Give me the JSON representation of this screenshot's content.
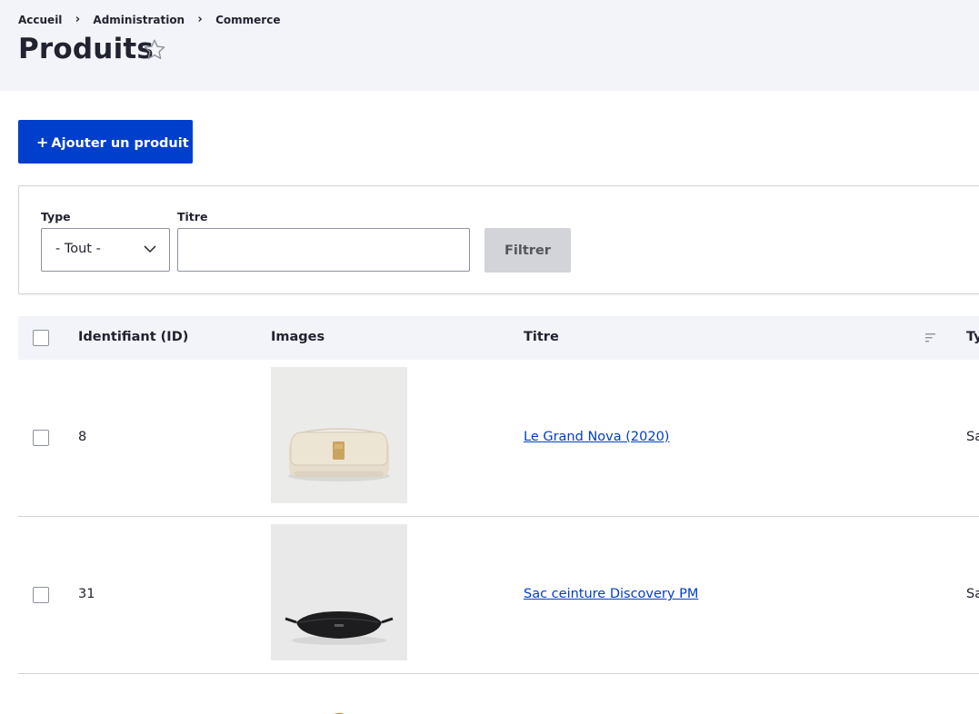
{
  "breadcrumb": {
    "items": [
      "Accueil",
      "Administration",
      "Commerce"
    ],
    "separator": "›"
  },
  "page": {
    "title": "Produits",
    "favorite_icon": "star-outline-icon"
  },
  "actions": {
    "add_product_plus": "+",
    "add_product_label": "Ajouter un produit",
    "accent_color": "#003ecc"
  },
  "filters": {
    "type_label": "Type",
    "type_selected": "- Tout -",
    "title_label": "Titre",
    "title_value": "",
    "submit_label": "Filtrer"
  },
  "table": {
    "columns": [
      "Identifiant (ID)",
      "Images",
      "Titre",
      "Ty"
    ],
    "sorted_column_icon": "sort-icon",
    "rows": [
      {
        "id": "8",
        "image": "cream-handbag-image",
        "title": "Le Grand Nova (2020)",
        "type": "Sa"
      },
      {
        "id": "31",
        "image": "black-belt-bag-image",
        "title": "Sac ceinture Discovery PM",
        "type": "Sa"
      }
    ]
  }
}
